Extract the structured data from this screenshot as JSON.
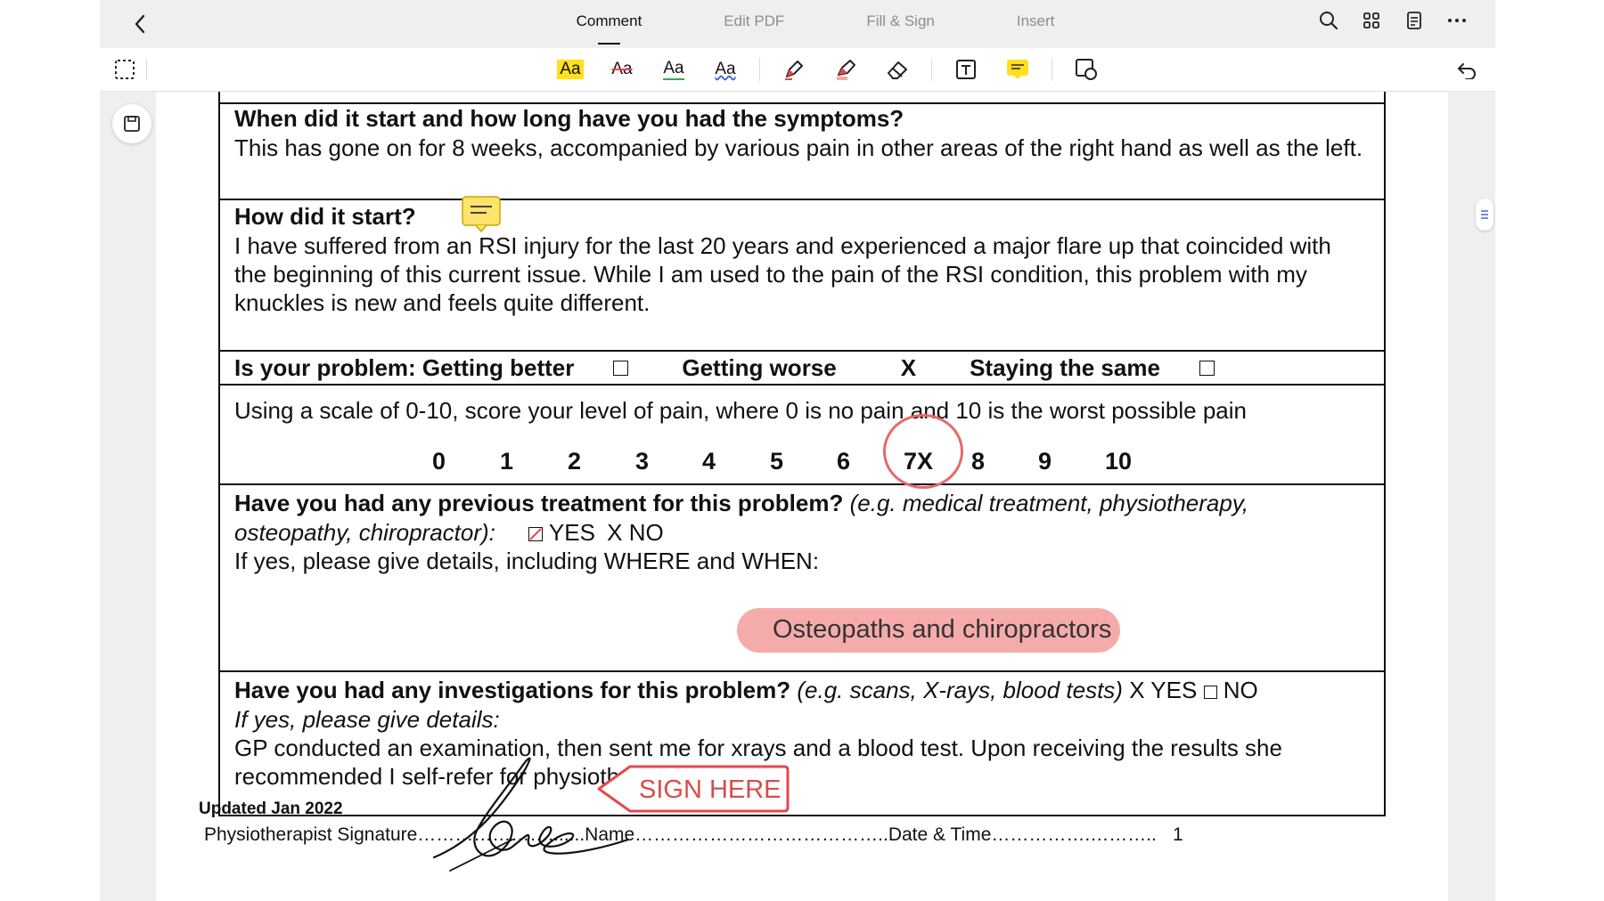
{
  "tabs": [
    {
      "label": "Comment",
      "active": true
    },
    {
      "label": "Edit PDF",
      "active": false
    },
    {
      "label": "Fill & Sign",
      "active": false
    },
    {
      "label": "Insert",
      "active": false
    }
  ],
  "top_icons": [
    "search-icon",
    "grid-view-icon",
    "outline-icon",
    "more-icon"
  ],
  "toolbar": {
    "tools": [
      {
        "name": "highlight-text-tool",
        "label": "Aa"
      },
      {
        "name": "strikethrough-tool",
        "label": "Aa"
      },
      {
        "name": "underline-tool",
        "label": "Aa"
      },
      {
        "name": "squiggly-tool",
        "label": "Aa"
      }
    ],
    "accent_yellow": "#ffe01b",
    "accent_red": "#e5484d",
    "accent_green": "#3aa655",
    "accent_blue": "#3a63d8"
  },
  "form": {
    "q1": "When did it start and how long have you had the symptoms?",
    "a1": "This has gone on for 8 weeks, accompanied by various pain in other areas of the right hand as well as the left.",
    "q2": "How did it start?",
    "a2": "I have suffered from an RSI injury for the last 20 years and experienced a major flare up that coincided with the beginning of this current issue. While I am used to the pain of the RSI condition, this problem with my knuckles is new and feels quite different.",
    "problem_label": "Is your problem: Getting better",
    "problem_worse": "Getting worse",
    "problem_worse_mark": "X",
    "problem_same": "Staying the same",
    "scale_prompt": "Using a scale of 0-10, score your level of pain, where 0 is no pain and 10 is the worst possible pain",
    "scale": [
      "0",
      "1",
      "2",
      "3",
      "4",
      "5",
      "6",
      "7X",
      "8",
      "9",
      "10"
    ],
    "q5": "Have you had any previous treatment for this problem?",
    "q5_hint": "(e.g. medical treatment, physiotherapy, osteopathy, chiropractor):",
    "q5_yes": "YES",
    "q5_no": "X NO",
    "q5_details": "If yes, please give details, including WHERE and WHEN:",
    "q5_answer": "Osteopaths and chiropractors",
    "q6": "Have you had any investigations for this problem?",
    "q6_hint": "(e.g. scans, X-rays, blood tests)",
    "q6_yes": "X YES",
    "q6_no": "NO",
    "q6_details_label": "If yes, please give details:",
    "q6_answer": "GP conducted an examination, then sent me for xrays and a blood test. Upon receiving the results she recommended I self-refer for physiotherapy."
  },
  "footer": {
    "updated": "Updated Jan 2022",
    "signature_line": "Physiotherapist Signature………………….......Name…………………………………..Date & Time…………….………..",
    "page_number": "1",
    "sign_here": "SIGN HERE"
  }
}
